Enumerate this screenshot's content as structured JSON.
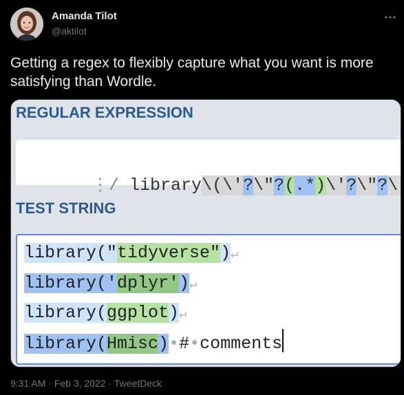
{
  "author": {
    "name": "Amanda Tilot",
    "handle": "@aktilot"
  },
  "tweet": {
    "text": "Getting a regex to flexibly capture what you want is more satisfying than Wordle."
  },
  "media": {
    "regex_heading": "REGULAR EXPRESSION",
    "test_heading": "TEST STRING",
    "regex_flags_icon": "⋮",
    "regex_delimiter": "/",
    "regex_tokens": [
      {
        "text": "library",
        "kind": "plain"
      },
      {
        "text": "\\(",
        "kind": "esc"
      },
      {
        "text": "\\'",
        "kind": "esc"
      },
      {
        "text": "?",
        "kind": "q"
      },
      {
        "text": "\\\"",
        "kind": "esc"
      },
      {
        "text": "?",
        "kind": "q"
      },
      {
        "text": "(",
        "kind": "grp"
      },
      {
        "text": ".*",
        "kind": "dot"
      },
      {
        "text": ")",
        "kind": "grp"
      },
      {
        "text": "\\'",
        "kind": "esc"
      },
      {
        "text": "?",
        "kind": "q"
      },
      {
        "text": "\\\"",
        "kind": "esc"
      },
      {
        "text": "?",
        "kind": "q"
      },
      {
        "text": "\\)",
        "kind": "esc"
      }
    ],
    "test_lines": [
      {
        "pre": "library(\"",
        "group": "tidyverse\"",
        "post": ")",
        "strong": false,
        "eol": "↵",
        "rest": ""
      },
      {
        "pre": "library('",
        "group": "dplyr'",
        "post": ")",
        "strong": true,
        "eol": "↵",
        "rest": ""
      },
      {
        "pre": "library(",
        "group": "ggplot",
        "post": ")",
        "strong": false,
        "eol": "↵",
        "rest": ""
      },
      {
        "pre": "library(",
        "group": "Hmisc",
        "post": ")",
        "strong": true,
        "eol": "",
        "rest": "•#•comments"
      }
    ]
  },
  "footer": {
    "time": "9:31 AM",
    "separator1": " · ",
    "date": "Feb 3, 2022",
    "separator2": " · ",
    "source": "TweetDeck"
  },
  "icons": {
    "more": "more-horizontal-icon"
  },
  "colors": {
    "background": "#000000",
    "heading_blue": "#2d5a8c",
    "match_light": "#cfe3fb",
    "match_strong": "#9fc2f2",
    "group_light": "#b6e2a4",
    "group_strong": "#93c785",
    "escape_gray": "#d8d8d8"
  }
}
